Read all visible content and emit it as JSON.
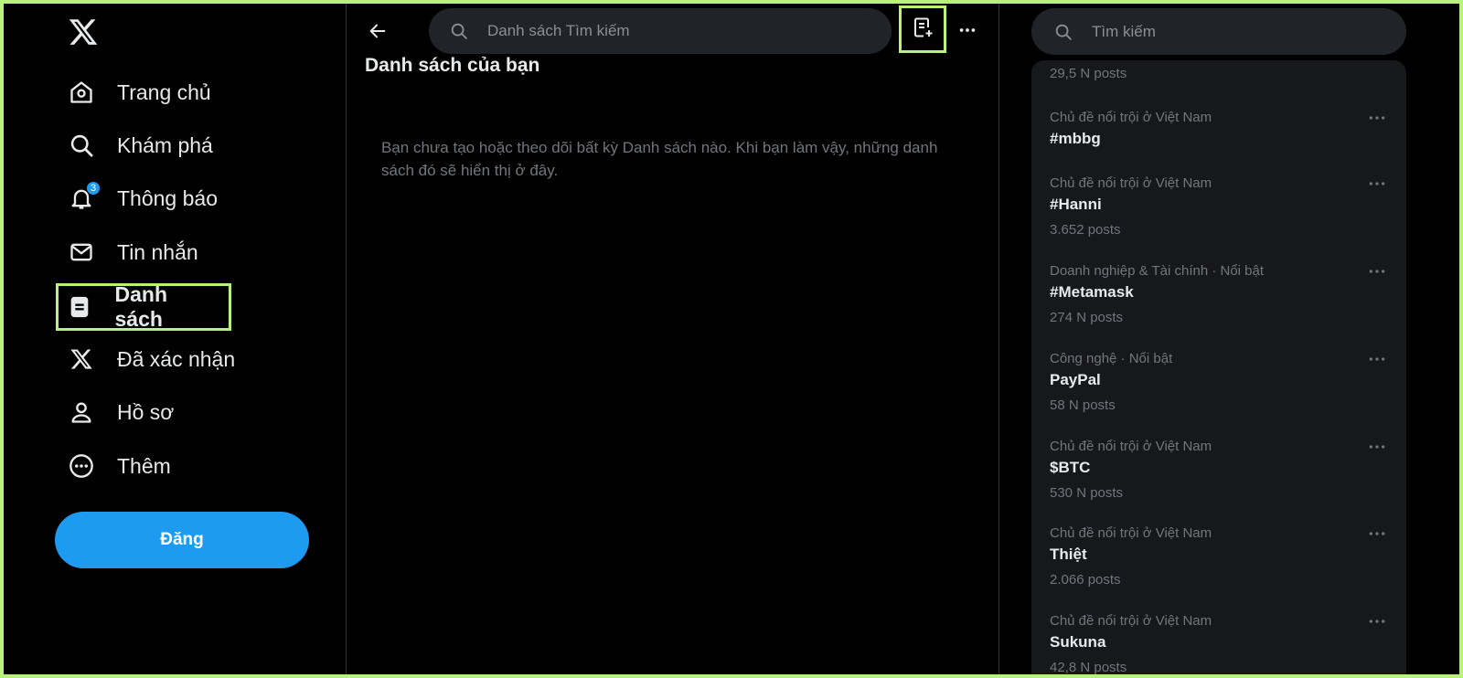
{
  "sidebar": {
    "items": [
      {
        "label": "Trang chủ",
        "icon": "home-icon"
      },
      {
        "label": "Khám phá",
        "icon": "search-icon"
      },
      {
        "label": "Thông báo",
        "icon": "bell-icon",
        "badge": "3"
      },
      {
        "label": "Tin nhắn",
        "icon": "mail-icon"
      },
      {
        "label": "Danh sách",
        "icon": "list-icon",
        "active": true
      },
      {
        "label": "Đã xác nhận",
        "icon": "x-logo-icon"
      },
      {
        "label": "Hồ sơ",
        "icon": "profile-icon"
      },
      {
        "label": "Thêm",
        "icon": "more-circle-icon"
      }
    ],
    "post_button": "Đăng"
  },
  "main": {
    "search_placeholder": "Danh sách Tìm kiếm",
    "title": "Danh sách của bạn",
    "empty_message": "Bạn chưa tạo hoặc theo dõi bất kỳ Danh sách nào. Khi bạn làm vậy, những danh sách đó sẽ hiển thị ở đây."
  },
  "right": {
    "search_placeholder": "Tìm kiếm",
    "top_count": "29,5 N posts",
    "trends": [
      {
        "category": "Chủ đề nổi trội ở Việt Nam",
        "name": "#mbbg",
        "count": ""
      },
      {
        "category": "Chủ đề nổi trội ở Việt Nam",
        "name": "#Hanni",
        "count": "3.652 posts"
      },
      {
        "category": "Doanh nghiệp & Tài chính · Nổi bật",
        "name": "#Metamask",
        "count": "274 N posts"
      },
      {
        "category": "Công nghệ · Nổi bật",
        "name": "PayPal",
        "count": "58 N posts"
      },
      {
        "category": "Chủ đề nổi trội ở Việt Nam",
        "name": "$BTC",
        "count": "530 N posts"
      },
      {
        "category": "Chủ đề nổi trội ở Việt Nam",
        "name": "Thiệt",
        "count": "2.066 posts"
      },
      {
        "category": "Chủ đề nổi trội ở Việt Nam",
        "name": "Sukuna",
        "count": "42,8 N posts"
      }
    ]
  },
  "colors": {
    "accent": "#1d9bf0",
    "highlight": "#b8f27a",
    "background": "#000000",
    "panel": "#16181c"
  }
}
